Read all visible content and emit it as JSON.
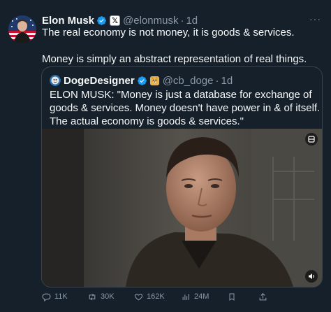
{
  "author": {
    "name": "Elon Musk",
    "handle": "@elonmusk",
    "separator": "·",
    "time": "1d",
    "affiliation_badge": "𝕏",
    "verified_color": "#1d9bf0"
  },
  "tweet": {
    "paragraphs": [
      "The real economy is not money, it is goods & services.",
      "Money is simply an abstract representation of real things."
    ]
  },
  "more_icon": "more-horizontal-icon",
  "quoted_tweet": {
    "author_name": "DogeDesigner",
    "handle": "@cb_doge",
    "separator": "·",
    "time": "1d",
    "text": "ELON MUSK: \"Money is just a database for exchange of goods & services. Money doesn't have power in & of itself. The actual economy is goods & services.\""
  },
  "actions": {
    "replies": "11K",
    "reposts": "30K",
    "likes": "162K",
    "views": "24M"
  },
  "colors": {
    "background": "#15202b",
    "text": "#f7f9f9",
    "muted": "#8b98a5",
    "border": "#38444d",
    "accent": "#1d9bf0"
  }
}
